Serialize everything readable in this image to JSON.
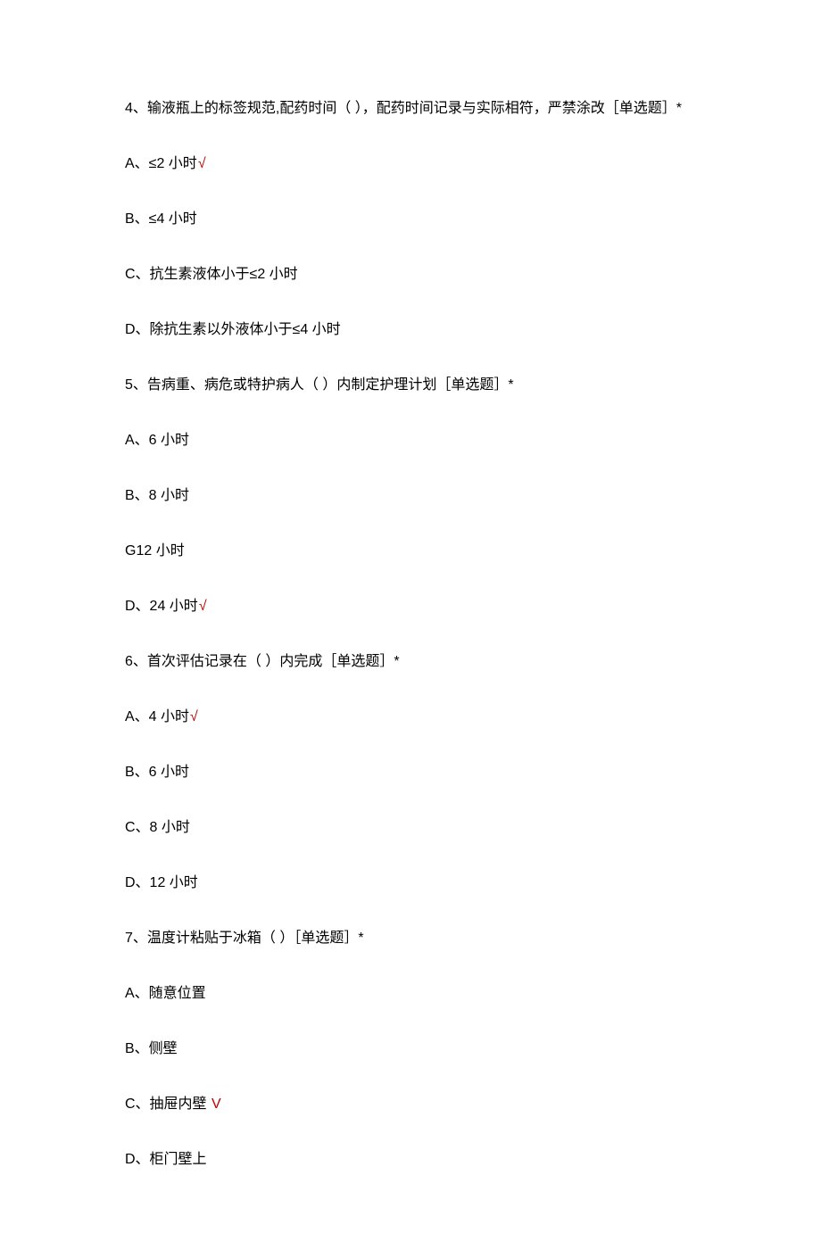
{
  "questions": [
    {
      "q": "4、输液瓶上的标签规范,配药时间（ ），配药时间记录与实际相符，严禁涂改［单选题］*",
      "options": [
        {
          "text": "A、≤2 小时",
          "correct": true
        },
        {
          "text": "B、≤4 小时",
          "correct": false
        },
        {
          "text": "C、抗生素液体小于≤2 小时",
          "correct": false
        },
        {
          "text": "D、除抗生素以外液体小于≤4 小时",
          "correct": false
        }
      ]
    },
    {
      "q": "5、告病重、病危或特护病人（ ）内制定护理计划［单选题］*",
      "options": [
        {
          "text": "A、6 小时",
          "correct": false
        },
        {
          "text": "B、8 小时",
          "correct": false
        },
        {
          "text": "G12 小时",
          "correct": false
        },
        {
          "text": "D、24 小时",
          "correct": true
        }
      ]
    },
    {
      "q": "6、首次评估记录在（ ）内完成［单选题］*",
      "options": [
        {
          "text": "A、4 小时",
          "correct": true
        },
        {
          "text": "B、6 小时",
          "correct": false
        },
        {
          "text": "C、8 小时",
          "correct": false
        },
        {
          "text": "D、12 小时",
          "correct": false
        }
      ]
    },
    {
      "q": "7、温度计粘贴于冰箱（ ）［单选题］*",
      "options": [
        {
          "text": "A、随意位置",
          "correct": false
        },
        {
          "text": "B、侧壁",
          "correct": false
        },
        {
          "text": "C、抽屉内壁",
          "correct": true,
          "mark": " V"
        },
        {
          "text": "D、柜门壁上",
          "correct": false
        }
      ]
    }
  ],
  "default_mark": "√"
}
